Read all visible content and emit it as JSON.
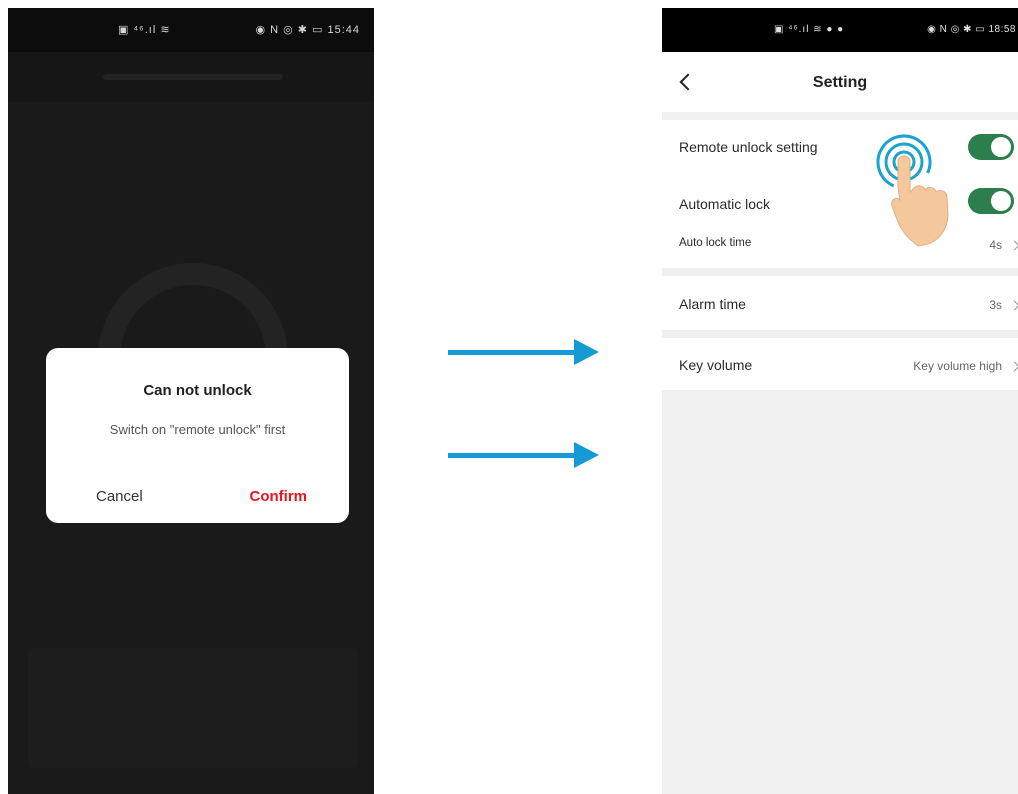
{
  "left_screen": {
    "status_left": "▣ ⁴⁶.ıl ≋",
    "status_right": "◉ N ◎ ✱ ▭ 15:44",
    "dialog": {
      "title": "Can not unlock",
      "message": "Switch on \"remote unlock\" first",
      "cancel_label": "Cancel",
      "confirm_label": "Confirm"
    }
  },
  "right_screen": {
    "status_left": "▣ ⁴⁶.ıl ≋ ● ●",
    "status_right": "◉ N ◎ ✱ ▭ 18:58",
    "title": "Setting",
    "remote_unlock_label": "Remote unlock setting",
    "remote_unlock_on": true,
    "automatic_lock_label": "Automatic lock",
    "automatic_lock_on": true,
    "auto_lock_time_label": "Auto lock time",
    "auto_lock_time_value": "4s",
    "alarm_time_label": "Alarm time",
    "alarm_time_value": "3s",
    "key_volume_label": "Key volume",
    "key_volume_value": "Key volume high"
  },
  "colors": {
    "accent_blue": "#159ad6",
    "toggle_green": "#2c7f4c",
    "confirm_red": "#e8141e",
    "hand_skin": "#f4c79d",
    "tap_ring": "#1ba3cf"
  },
  "icons": [
    "back-chevron-icon",
    "chevron-right-icon",
    "tap-gesture-icon",
    "pointing-hand-icon",
    "arrow-right-icon"
  ]
}
